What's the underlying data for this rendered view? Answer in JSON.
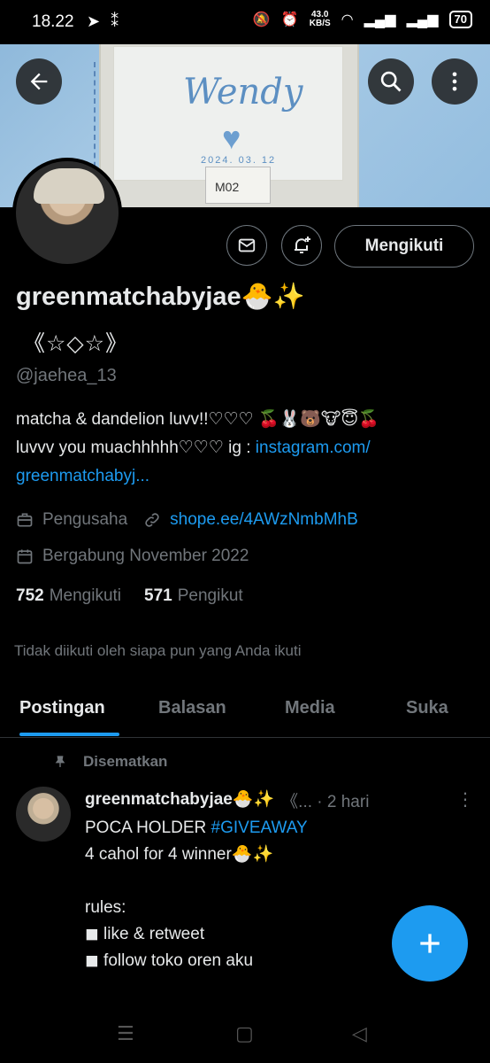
{
  "status_bar": {
    "time": "18.22",
    "net_speed_value": "43.0",
    "net_speed_unit": "KB/S",
    "battery": "70"
  },
  "banner": {
    "title": "Wendy",
    "date": "2024. 03. 12",
    "tag": "M02"
  },
  "profile": {
    "display_name": "greenmatchabyjae🐣✨",
    "name_line2": "《☆◇☆》",
    "handle": "@jaehea_13",
    "bio_line1": "matcha & dandelion luvv!!♡♡♡ 🍒🐰🐻🐮😇🍒",
    "bio_line2_prefix": "luvvv you muachhhhh♡♡♡ ig : ",
    "bio_link": "instagram.com/",
    "bio_link2": "greenmatchabyj...",
    "category": "Pengusaha",
    "website": "shope.ee/4AWzNmbMhB",
    "joined": "Bergabung November 2022",
    "following_count": "752",
    "following_label": "Mengikuti",
    "followers_count": "571",
    "followers_label": "Pengikut",
    "not_followed_text": "Tidak diikuti oleh siapa pun yang Anda ikuti",
    "follow_button": "Mengikuti"
  },
  "tabs": [
    "Postingan",
    "Balasan",
    "Media",
    "Suka"
  ],
  "post": {
    "pinned_label": "Disematkan",
    "author": "greenmatchabyjae🐣✨",
    "author_suffix": "《... · 2 hari",
    "line1_prefix": "POCA HOLDER ",
    "hashtag": "#GIVEAWAY",
    "body": "\n4 cahol for 4 winner🐣✨\n\nrules:\n◼ like & retweet\n◼  follow toko oren aku"
  }
}
